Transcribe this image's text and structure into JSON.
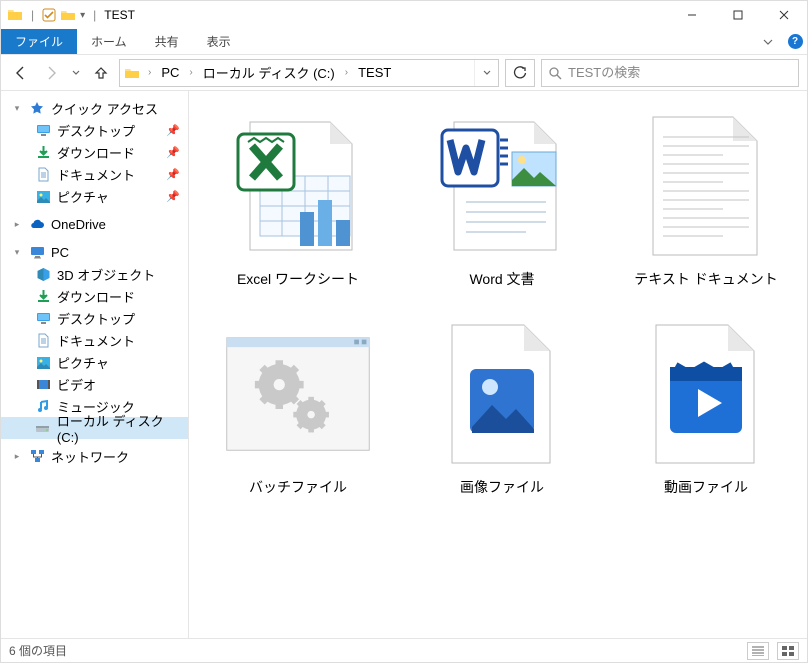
{
  "window": {
    "title": "TEST"
  },
  "ribbon": {
    "tabs": {
      "file": "ファイル",
      "home": "ホーム",
      "share": "共有",
      "view": "表示"
    }
  },
  "breadcrumb": {
    "items": [
      "PC",
      "ローカル ディスク (C:)",
      "TEST"
    ]
  },
  "search": {
    "placeholder": "TESTの検索"
  },
  "nav": {
    "quick_access": "クイック アクセス",
    "qa_items": [
      {
        "label": "デスクトップ",
        "icon": "desktop"
      },
      {
        "label": "ダウンロード",
        "icon": "download"
      },
      {
        "label": "ドキュメント",
        "icon": "document"
      },
      {
        "label": "ピクチャ",
        "icon": "pictures"
      }
    ],
    "onedrive": "OneDrive",
    "pc": "PC",
    "pc_items": [
      {
        "label": "3D オブジェクト",
        "icon": "3d"
      },
      {
        "label": "ダウンロード",
        "icon": "download"
      },
      {
        "label": "デスクトップ",
        "icon": "desktop"
      },
      {
        "label": "ドキュメント",
        "icon": "document"
      },
      {
        "label": "ピクチャ",
        "icon": "pictures"
      },
      {
        "label": "ビデオ",
        "icon": "video"
      },
      {
        "label": "ミュージック",
        "icon": "music"
      },
      {
        "label": "ローカル ディスク (C:)",
        "icon": "drive"
      }
    ],
    "network": "ネットワーク"
  },
  "files": [
    {
      "label": "Excel ワークシート",
      "kind": "excel"
    },
    {
      "label": "Word 文書",
      "kind": "word"
    },
    {
      "label": "テキスト ドキュメント",
      "kind": "text"
    },
    {
      "label": "バッチファイル",
      "kind": "batch"
    },
    {
      "label": "画像ファイル",
      "kind": "image"
    },
    {
      "label": "動画ファイル",
      "kind": "video"
    }
  ],
  "status": {
    "count_text": "6 個の項目"
  }
}
